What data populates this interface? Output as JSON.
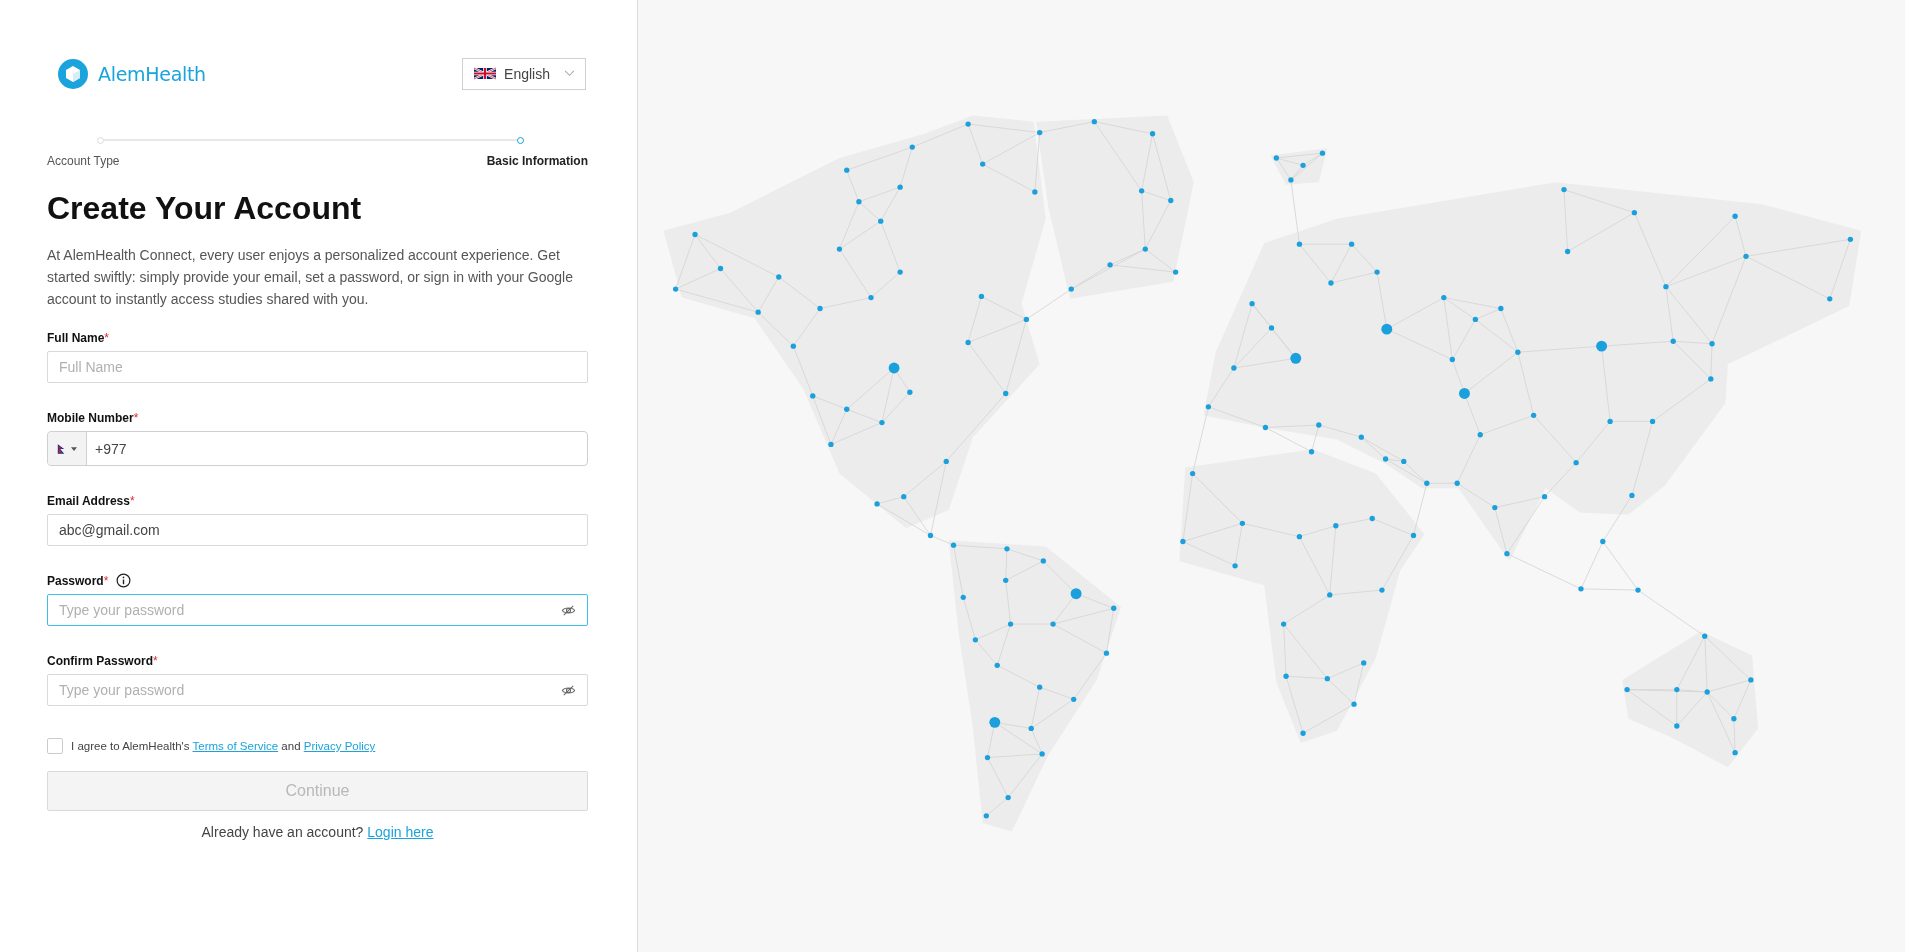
{
  "brand": {
    "name": "AlemHealth"
  },
  "language": {
    "label": "English"
  },
  "steps": [
    {
      "label": "Account Type",
      "selected": false
    },
    {
      "label": "Basic Information",
      "selected": true
    }
  ],
  "heading": "Create Your Account",
  "intro": "At AlemHealth Connect, every user enjoys a personalized account experience. Get started swiftly: simply provide your email, set a password, or sign in with your Google account to instantly access studies shared with you.",
  "fields": [
    {
      "kind": "text",
      "label": "Full Name",
      "required": "*",
      "placeholder": "Full Name",
      "focused": false
    },
    {
      "kind": "phone",
      "label": "Mobile Number",
      "required": "*",
      "value": "+977",
      "focused": false
    },
    {
      "kind": "text",
      "label": "Email Address",
      "required": "*",
      "value": "abc@gmail.com",
      "focused": false
    },
    {
      "kind": "password",
      "label": "Password",
      "required": "*",
      "placeholder": "Type your password",
      "info": true,
      "focused": true
    },
    {
      "kind": "password",
      "label": "Confirm Password",
      "required": "*",
      "placeholder": "Type your password",
      "info": false,
      "focused": false
    }
  ],
  "agreement": {
    "checked": false,
    "text_before": "I agree to AlemHealth's",
    "link_1": "Terms of Service",
    "text_middle": "and",
    "link_2": "Privacy Policy"
  },
  "continue_button": {
    "label": "Continue",
    "disabled": true
  },
  "login": {
    "text": "Already have an account?",
    "link": "Login here"
  }
}
